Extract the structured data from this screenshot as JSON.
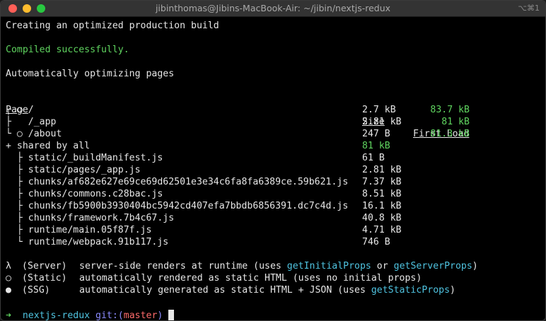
{
  "window": {
    "title": "jibinthomas@Jibins-MacBook-Air: ~/jibin/nextjs-redux",
    "shortcut": "⌥⌘1"
  },
  "output": {
    "creating": "Creating an optimized production build",
    "compiled": "Compiled successfully.",
    "optimizing": "Automatically optimizing pages"
  },
  "table": {
    "headers": {
      "page": "Page",
      "size": "Size",
      "first_load": "First Load"
    },
    "pages": [
      {
        "prefix": "┌ ○ ",
        "name": "/",
        "size": "2.7 kB",
        "first_load": "83.7 kB"
      },
      {
        "prefix": "├   ",
        "name": "/_app",
        "size": "2.81 kB",
        "first_load": "81 kB"
      },
      {
        "prefix": "└ ○ ",
        "name": "/about",
        "size": "247 B",
        "first_load": "81.3 kB"
      }
    ],
    "shared": {
      "label": "+ shared by all",
      "size": "81 kB"
    },
    "chunks": [
      {
        "prefix": "  ├ ",
        "name": "static/_buildManifest.js",
        "size": "61 B"
      },
      {
        "prefix": "  ├ ",
        "name": "static/pages/_app.js",
        "size": "2.81 kB"
      },
      {
        "prefix": "  ├ ",
        "name": "chunks/af682e627e69ce69d62501e3e34c6fa8fa6389ce.59b621.js",
        "size": "7.37 kB"
      },
      {
        "prefix": "  ├ ",
        "name": "chunks/commons.c28bac.js",
        "size": "8.51 kB"
      },
      {
        "prefix": "  ├ ",
        "name": "chunks/fb5900b3930404bc5942cd407efa7bbdb6856391.dc7c4d.js",
        "size": "16.1 kB"
      },
      {
        "prefix": "  ├ ",
        "name": "chunks/framework.7b4c67.js",
        "size": "40.8 kB"
      },
      {
        "prefix": "  ├ ",
        "name": "runtime/main.05f87f.js",
        "size": "4.71 kB"
      },
      {
        "prefix": "  └ ",
        "name": "runtime/webpack.91b117.js",
        "size": "746 B"
      }
    ]
  },
  "legend": [
    {
      "symbol": "λ",
      "key": "(Server)",
      "parts": [
        {
          "text": "server-side renders at runtime (uses ",
          "color": ""
        },
        {
          "text": "getInitialProps",
          "color": "cyan"
        },
        {
          "text": " or ",
          "color": ""
        },
        {
          "text": "getServerProps",
          "color": "cyan"
        },
        {
          "text": ")",
          "color": ""
        }
      ]
    },
    {
      "symbol": "○",
      "key": "(Static)",
      "parts": [
        {
          "text": "automatically rendered as static HTML (uses no initial props)",
          "color": ""
        }
      ]
    },
    {
      "symbol": "●",
      "key": "(SSG)",
      "parts": [
        {
          "text": "automatically generated as static HTML + JSON (uses ",
          "color": ""
        },
        {
          "text": "getStaticProps",
          "color": "cyan"
        },
        {
          "text": ")",
          "color": ""
        }
      ]
    }
  ],
  "prompt": {
    "arrow": "➜",
    "dir": "nextjs-redux",
    "git_label": "git:(",
    "branch": "master",
    "git_close": ")"
  },
  "colors": {
    "green": "#5fd35f",
    "cyan": "#4fc3e0",
    "purple": "#8b8bff",
    "red": "#ff6b6b"
  }
}
